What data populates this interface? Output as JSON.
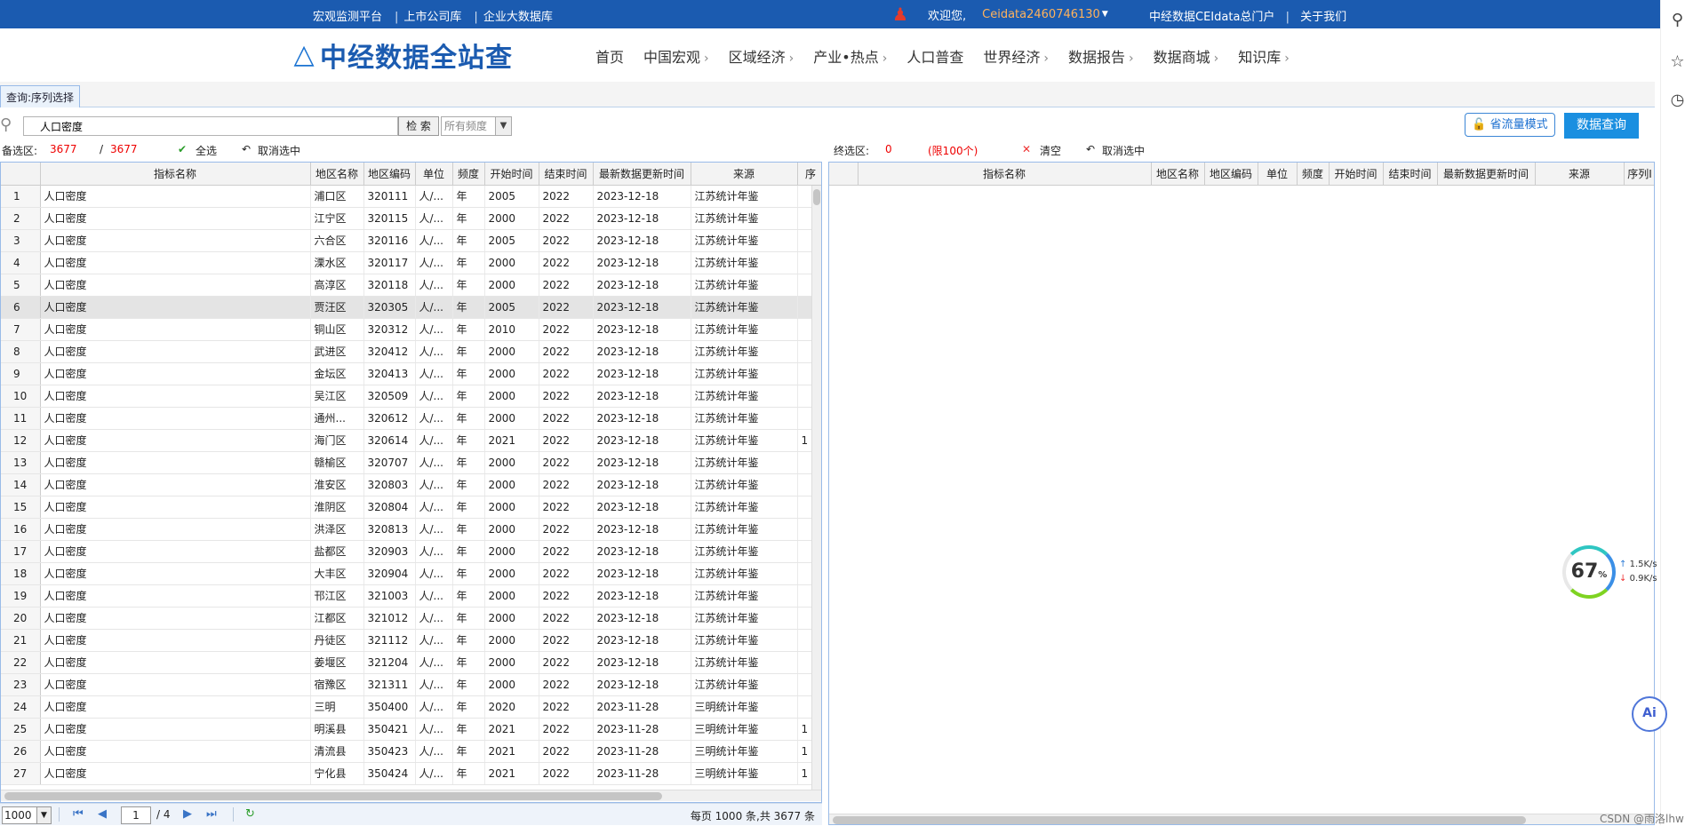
{
  "topbar": {
    "links": [
      "宏观监测平台",
      "上市公司库",
      "企业大数据库"
    ],
    "welcome": "欢迎您,",
    "username": "Ceidata2460746130",
    "portal": "中经数据CEIdata总门户",
    "about": "关于我们"
  },
  "header": {
    "logo_text": "中经数据全站查",
    "nav": [
      {
        "label": "首页",
        "chevron": false
      },
      {
        "label": "中国宏观",
        "chevron": true
      },
      {
        "label": "区域经济",
        "chevron": true
      },
      {
        "label": "产业•热点",
        "chevron": true
      },
      {
        "label": "人口普查",
        "chevron": false
      },
      {
        "label": "世界经济",
        "chevron": true
      },
      {
        "label": "数据报告",
        "chevron": true
      },
      {
        "label": "数据商城",
        "chevron": true
      },
      {
        "label": "知识库",
        "chevron": true
      }
    ]
  },
  "tab": {
    "label": "查询:序列选择"
  },
  "search": {
    "value": "人口密度",
    "button": "检 索",
    "frequency_placeholder": "所有频度",
    "flow_mode": "省流量模式",
    "query": "数据查询"
  },
  "status": {
    "candidate_label": "备选区:",
    "candidate_count": "3677",
    "candidate_total": "3677",
    "select_all": "全选",
    "unselect": "取消选中",
    "final_label": "终选区:",
    "final_count": "0",
    "final_limit": "(限100个)",
    "clear": "清空",
    "unselect2": "取消选中"
  },
  "left_table": {
    "columns": [
      "",
      "指标名称",
      "地区名称",
      "地区编码",
      "单位",
      "频度",
      "开始时间",
      "结束时间",
      "最新数据更新时间",
      "来源",
      "序"
    ],
    "rows": [
      [
        "1",
        "人口密度",
        "浦口区",
        "320111",
        "人/...",
        "年",
        "2005",
        "2022",
        "2023-12-18",
        "江苏统计年鉴",
        ""
      ],
      [
        "2",
        "人口密度",
        "江宁区",
        "320115",
        "人/...",
        "年",
        "2000",
        "2022",
        "2023-12-18",
        "江苏统计年鉴",
        ""
      ],
      [
        "3",
        "人口密度",
        "六合区",
        "320116",
        "人/...",
        "年",
        "2005",
        "2022",
        "2023-12-18",
        "江苏统计年鉴",
        ""
      ],
      [
        "4",
        "人口密度",
        "溧水区",
        "320117",
        "人/...",
        "年",
        "2000",
        "2022",
        "2023-12-18",
        "江苏统计年鉴",
        ""
      ],
      [
        "5",
        "人口密度",
        "高淳区",
        "320118",
        "人/...",
        "年",
        "2000",
        "2022",
        "2023-12-18",
        "江苏统计年鉴",
        ""
      ],
      [
        "6",
        "人口密度",
        "贾汪区",
        "320305",
        "人/...",
        "年",
        "2005",
        "2022",
        "2023-12-18",
        "江苏统计年鉴",
        ""
      ],
      [
        "7",
        "人口密度",
        "铜山区",
        "320312",
        "人/...",
        "年",
        "2010",
        "2022",
        "2023-12-18",
        "江苏统计年鉴",
        ""
      ],
      [
        "8",
        "人口密度",
        "武进区",
        "320412",
        "人/...",
        "年",
        "2000",
        "2022",
        "2023-12-18",
        "江苏统计年鉴",
        ""
      ],
      [
        "9",
        "人口密度",
        "金坛区",
        "320413",
        "人/...",
        "年",
        "2000",
        "2022",
        "2023-12-18",
        "江苏统计年鉴",
        ""
      ],
      [
        "10",
        "人口密度",
        "吴江区",
        "320509",
        "人/...",
        "年",
        "2000",
        "2022",
        "2023-12-18",
        "江苏统计年鉴",
        ""
      ],
      [
        "11",
        "人口密度",
        "通州...",
        "320612",
        "人/...",
        "年",
        "2000",
        "2022",
        "2023-12-18",
        "江苏统计年鉴",
        ""
      ],
      [
        "12",
        "人口密度",
        "海门区",
        "320614",
        "人/...",
        "年",
        "2021",
        "2022",
        "2023-12-18",
        "江苏统计年鉴",
        "1"
      ],
      [
        "13",
        "人口密度",
        "赣榆区",
        "320707",
        "人/...",
        "年",
        "2000",
        "2022",
        "2023-12-18",
        "江苏统计年鉴",
        ""
      ],
      [
        "14",
        "人口密度",
        "淮安区",
        "320803",
        "人/...",
        "年",
        "2000",
        "2022",
        "2023-12-18",
        "江苏统计年鉴",
        ""
      ],
      [
        "15",
        "人口密度",
        "淮阴区",
        "320804",
        "人/...",
        "年",
        "2000",
        "2022",
        "2023-12-18",
        "江苏统计年鉴",
        ""
      ],
      [
        "16",
        "人口密度",
        "洪泽区",
        "320813",
        "人/...",
        "年",
        "2000",
        "2022",
        "2023-12-18",
        "江苏统计年鉴",
        ""
      ],
      [
        "17",
        "人口密度",
        "盐都区",
        "320903",
        "人/...",
        "年",
        "2000",
        "2022",
        "2023-12-18",
        "江苏统计年鉴",
        ""
      ],
      [
        "18",
        "人口密度",
        "大丰区",
        "320904",
        "人/...",
        "年",
        "2000",
        "2022",
        "2023-12-18",
        "江苏统计年鉴",
        ""
      ],
      [
        "19",
        "人口密度",
        "邗江区",
        "321003",
        "人/...",
        "年",
        "2000",
        "2022",
        "2023-12-18",
        "江苏统计年鉴",
        ""
      ],
      [
        "20",
        "人口密度",
        "江都区",
        "321012",
        "人/...",
        "年",
        "2000",
        "2022",
        "2023-12-18",
        "江苏统计年鉴",
        ""
      ],
      [
        "21",
        "人口密度",
        "丹徒区",
        "321112",
        "人/...",
        "年",
        "2000",
        "2022",
        "2023-12-18",
        "江苏统计年鉴",
        ""
      ],
      [
        "22",
        "人口密度",
        "姜堰区",
        "321204",
        "人/...",
        "年",
        "2000",
        "2022",
        "2023-12-18",
        "江苏统计年鉴",
        ""
      ],
      [
        "23",
        "人口密度",
        "宿豫区",
        "321311",
        "人/...",
        "年",
        "2000",
        "2022",
        "2023-12-18",
        "江苏统计年鉴",
        ""
      ],
      [
        "24",
        "人口密度",
        "三明",
        "350400",
        "人/...",
        "年",
        "2020",
        "2022",
        "2023-11-28",
        "三明统计年鉴",
        ""
      ],
      [
        "25",
        "人口密度",
        "明溪县",
        "350421",
        "人/...",
        "年",
        "2021",
        "2022",
        "2023-11-28",
        "三明统计年鉴",
        "1"
      ],
      [
        "26",
        "人口密度",
        "清流县",
        "350423",
        "人/...",
        "年",
        "2021",
        "2022",
        "2023-11-28",
        "三明统计年鉴",
        "1"
      ],
      [
        "27",
        "人口密度",
        "宁化县",
        "350424",
        "人/...",
        "年",
        "2021",
        "2022",
        "2023-11-28",
        "三明统计年鉴",
        "1"
      ]
    ]
  },
  "right_table": {
    "columns": [
      "",
      "指标名称",
      "地区名称",
      "地区编码",
      "单位",
      "频度",
      "开始时间",
      "结束时间",
      "最新数据更新时间",
      "来源",
      "序列I"
    ]
  },
  "pager": {
    "page_size": "1000",
    "page": "1",
    "total_pages": "/ 4",
    "info": "每页 1000 条,共 3677 条"
  },
  "speed": {
    "percent": "67",
    "unit": "%",
    "up": "1.5K/s",
    "down": "0.9K/s"
  },
  "ai_label": "Ai",
  "watermark": "CSDN @雨洛lhw"
}
